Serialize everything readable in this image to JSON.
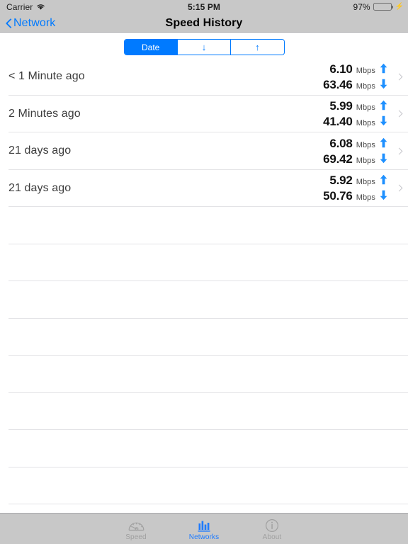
{
  "status_bar": {
    "carrier": "Carrier",
    "wifi_icon": "wifi-icon",
    "time": "5:15 PM",
    "battery_percent": "97%",
    "battery_icon": "battery-icon",
    "charging_icon": "charging-bolt-icon"
  },
  "nav_bar": {
    "back_icon": "chevron-left-icon",
    "back_label": "Network",
    "title": "Speed History"
  },
  "segmented_control": {
    "name": "sort-segmented-control",
    "selected_index": 0,
    "segments": [
      {
        "label": "Date",
        "icon": "",
        "selected": true
      },
      {
        "label": "",
        "icon": "arrow-down-icon",
        "glyph": "↓",
        "selected": false
      },
      {
        "label": "",
        "icon": "arrow-up-icon",
        "glyph": "↑",
        "selected": false
      }
    ]
  },
  "list": {
    "unit": "Mbps",
    "upload_icon": "arrow-up-icon",
    "download_icon": "arrow-down-icon",
    "disclosure_icon": "chevron-right-icon",
    "rows": [
      {
        "title": "< 1 Minute ago",
        "upload": "6.10",
        "download": "63.46",
        "unit": "Mbps"
      },
      {
        "title": "2 Minutes ago",
        "upload": "5.99",
        "download": "41.40",
        "unit": "Mbps"
      },
      {
        "title": "21 days ago",
        "upload": "6.08",
        "download": "69.42",
        "unit": "Mbps"
      },
      {
        "title": "21 days ago",
        "upload": "5.92",
        "download": "50.76",
        "unit": "Mbps"
      }
    ],
    "empty_row_count": 9
  },
  "tab_bar": {
    "tabs": [
      {
        "label": "Speed",
        "icon": "speedometer-icon",
        "active": false
      },
      {
        "label": "Networks",
        "icon": "bar-chart-icon",
        "active": true
      },
      {
        "label": "About",
        "icon": "info-circle-icon",
        "active": false
      }
    ]
  },
  "colors": {
    "accent": "#007aff",
    "tab_active": "#1e7bff",
    "chrome": "#c8c8c8",
    "separator": "#e3e3e6",
    "battery_fill": "#4cd964",
    "inactive_tab": "#a0a0a0"
  }
}
